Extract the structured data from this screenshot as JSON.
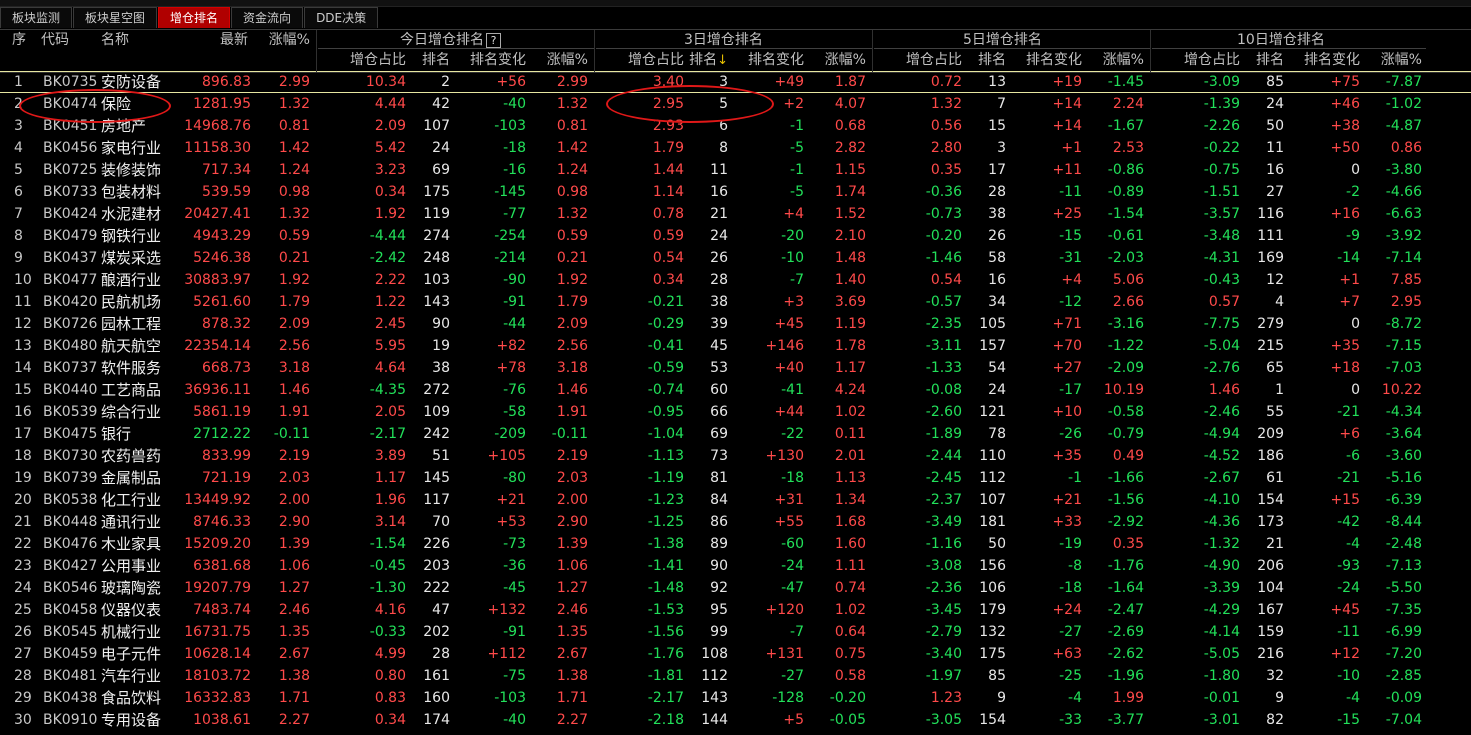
{
  "tabs": [
    {
      "label": "板块监测",
      "active": false
    },
    {
      "label": "板块星空图",
      "active": false
    },
    {
      "label": "增仓排名",
      "active": true
    },
    {
      "label": "资金流向",
      "active": false
    },
    {
      "label": "DDE决策",
      "active": false
    }
  ],
  "header": {
    "seq": "序",
    "code": "代码",
    "name": "名称",
    "latest": "最新",
    "change": "涨幅%",
    "groups": [
      "今日增仓排名",
      "3日增仓排名",
      "5日增仓排名",
      "10日增仓排名"
    ],
    "help_mark": "?",
    "sub": {
      "ratio": "增仓占比",
      "rank": "排名",
      "rank_change": "排名变化",
      "pct": "涨幅%"
    },
    "sort_arrow": "↓"
  },
  "colors": {
    "up": "#ff4a4a",
    "down": "#22e05a",
    "flat": "#e8e8e8",
    "active_tab": "#b00000",
    "highlight_circle": "#e01818"
  },
  "rows": [
    [
      "1",
      "BK0735",
      "安防设备",
      "896.83",
      "2.99",
      "10.34",
      "2",
      "+56",
      "2.99",
      "3.40",
      "3",
      "+49",
      "1.87",
      "0.72",
      "13",
      "+19",
      "-1.45",
      "-3.09",
      "85",
      "+75",
      "-7.87"
    ],
    [
      "2",
      "BK0474",
      "保险",
      "1281.95",
      "1.32",
      "4.44",
      "42",
      "-40",
      "1.32",
      "2.95",
      "5",
      "+2",
      "4.07",
      "1.32",
      "7",
      "+14",
      "2.24",
      "-1.39",
      "24",
      "+46",
      "-1.02"
    ],
    [
      "3",
      "BK0451",
      "房地产",
      "14968.76",
      "0.81",
      "2.09",
      "107",
      "-103",
      "0.81",
      "2.93",
      "6",
      "-1",
      "0.68",
      "0.56",
      "15",
      "+14",
      "-1.67",
      "-2.26",
      "50",
      "+38",
      "-4.87"
    ],
    [
      "4",
      "BK0456",
      "家电行业",
      "11158.30",
      "1.42",
      "5.42",
      "24",
      "-18",
      "1.42",
      "1.79",
      "8",
      "-5",
      "2.82",
      "2.80",
      "3",
      "+1",
      "2.53",
      "-0.22",
      "11",
      "+50",
      "0.86"
    ],
    [
      "5",
      "BK0725",
      "装修装饰",
      "717.34",
      "1.24",
      "3.23",
      "69",
      "-16",
      "1.24",
      "1.44",
      "11",
      "-1",
      "1.15",
      "0.35",
      "17",
      "+11",
      "-0.86",
      "-0.75",
      "16",
      "0",
      "-3.80"
    ],
    [
      "6",
      "BK0733",
      "包装材料",
      "539.59",
      "0.98",
      "0.34",
      "175",
      "-145",
      "0.98",
      "1.14",
      "16",
      "-5",
      "1.74",
      "-0.36",
      "28",
      "-11",
      "-0.89",
      "-1.51",
      "27",
      "-2",
      "-4.66"
    ],
    [
      "7",
      "BK0424",
      "水泥建材",
      "20427.41",
      "1.32",
      "1.92",
      "119",
      "-77",
      "1.32",
      "0.78",
      "21",
      "+4",
      "1.52",
      "-0.73",
      "38",
      "+25",
      "-1.54",
      "-3.57",
      "116",
      "+16",
      "-6.63"
    ],
    [
      "8",
      "BK0479",
      "钢铁行业",
      "4943.29",
      "0.59",
      "-4.44",
      "274",
      "-254",
      "0.59",
      "0.59",
      "24",
      "-20",
      "2.10",
      "-0.20",
      "26",
      "-15",
      "-0.61",
      "-3.48",
      "111",
      "-9",
      "-3.92"
    ],
    [
      "9",
      "BK0437",
      "煤炭采选",
      "5246.38",
      "0.21",
      "-2.42",
      "248",
      "-214",
      "0.21",
      "0.54",
      "26",
      "-10",
      "1.48",
      "-1.46",
      "58",
      "-31",
      "-2.03",
      "-4.31",
      "169",
      "-14",
      "-7.14"
    ],
    [
      "10",
      "BK0477",
      "酿酒行业",
      "30883.97",
      "1.92",
      "2.22",
      "103",
      "-90",
      "1.92",
      "0.34",
      "28",
      "-7",
      "1.40",
      "0.54",
      "16",
      "+4",
      "5.06",
      "-0.43",
      "12",
      "+1",
      "7.85"
    ],
    [
      "11",
      "BK0420",
      "民航机场",
      "5261.60",
      "1.79",
      "1.22",
      "143",
      "-91",
      "1.79",
      "-0.21",
      "38",
      "+3",
      "3.69",
      "-0.57",
      "34",
      "-12",
      "2.66",
      "0.57",
      "4",
      "+7",
      "2.95"
    ],
    [
      "12",
      "BK0726",
      "园林工程",
      "878.32",
      "2.09",
      "2.45",
      "90",
      "-44",
      "2.09",
      "-0.29",
      "39",
      "+45",
      "1.19",
      "-2.35",
      "105",
      "+71",
      "-3.16",
      "-7.75",
      "279",
      "0",
      "-8.72"
    ],
    [
      "13",
      "BK0480",
      "航天航空",
      "22354.14",
      "2.56",
      "5.95",
      "19",
      "+82",
      "2.56",
      "-0.41",
      "45",
      "+146",
      "1.78",
      "-3.11",
      "157",
      "+70",
      "-1.22",
      "-5.04",
      "215",
      "+35",
      "-7.15"
    ],
    [
      "14",
      "BK0737",
      "软件服务",
      "668.73",
      "3.18",
      "4.64",
      "38",
      "+78",
      "3.18",
      "-0.59",
      "53",
      "+40",
      "1.17",
      "-1.33",
      "54",
      "+27",
      "-2.09",
      "-2.76",
      "65",
      "+18",
      "-7.03"
    ],
    [
      "15",
      "BK0440",
      "工艺商品",
      "36936.11",
      "1.46",
      "-4.35",
      "272",
      "-76",
      "1.46",
      "-0.74",
      "60",
      "-41",
      "4.24",
      "-0.08",
      "24",
      "-17",
      "10.19",
      "1.46",
      "1",
      "0",
      "10.22"
    ],
    [
      "16",
      "BK0539",
      "综合行业",
      "5861.19",
      "1.91",
      "2.05",
      "109",
      "-58",
      "1.91",
      "-0.95",
      "66",
      "+44",
      "1.02",
      "-2.60",
      "121",
      "+10",
      "-0.58",
      "-2.46",
      "55",
      "-21",
      "-4.34"
    ],
    [
      "17",
      "BK0475",
      "银行",
      "2712.22",
      "-0.11",
      "-2.17",
      "242",
      "-209",
      "-0.11",
      "-1.04",
      "69",
      "-22",
      "0.11",
      "-1.89",
      "78",
      "-26",
      "-0.79",
      "-4.94",
      "209",
      "+6",
      "-3.64"
    ],
    [
      "18",
      "BK0730",
      "农药兽药",
      "833.99",
      "2.19",
      "3.89",
      "51",
      "+105",
      "2.19",
      "-1.13",
      "73",
      "+130",
      "2.01",
      "-2.44",
      "110",
      "+35",
      "0.49",
      "-4.52",
      "186",
      "-6",
      "-3.60"
    ],
    [
      "19",
      "BK0739",
      "金属制品",
      "721.19",
      "2.03",
      "1.17",
      "145",
      "-80",
      "2.03",
      "-1.19",
      "81",
      "-18",
      "1.13",
      "-2.45",
      "112",
      "-1",
      "-1.66",
      "-2.67",
      "61",
      "-21",
      "-5.16"
    ],
    [
      "20",
      "BK0538",
      "化工行业",
      "13449.92",
      "2.00",
      "1.96",
      "117",
      "+21",
      "2.00",
      "-1.23",
      "84",
      "+31",
      "1.34",
      "-2.37",
      "107",
      "+21",
      "-1.56",
      "-4.10",
      "154",
      "+15",
      "-6.39"
    ],
    [
      "21",
      "BK0448",
      "通讯行业",
      "8746.33",
      "2.90",
      "3.14",
      "70",
      "+53",
      "2.90",
      "-1.25",
      "86",
      "+55",
      "1.68",
      "-3.49",
      "181",
      "+33",
      "-2.92",
      "-4.36",
      "173",
      "-42",
      "-8.44"
    ],
    [
      "22",
      "BK0476",
      "木业家具",
      "15209.20",
      "1.39",
      "-1.54",
      "226",
      "-73",
      "1.39",
      "-1.38",
      "89",
      "-60",
      "1.60",
      "-1.16",
      "50",
      "-19",
      "0.35",
      "-1.32",
      "21",
      "-4",
      "-2.48"
    ],
    [
      "23",
      "BK0427",
      "公用事业",
      "6381.68",
      "1.06",
      "-0.45",
      "203",
      "-36",
      "1.06",
      "-1.41",
      "90",
      "-24",
      "1.11",
      "-3.08",
      "156",
      "-8",
      "-1.76",
      "-4.90",
      "206",
      "-93",
      "-7.13"
    ],
    [
      "24",
      "BK0546",
      "玻璃陶瓷",
      "19207.79",
      "1.27",
      "-1.30",
      "222",
      "-45",
      "1.27",
      "-1.48",
      "92",
      "-47",
      "0.74",
      "-2.36",
      "106",
      "-18",
      "-1.64",
      "-3.39",
      "104",
      "-24",
      "-5.50"
    ],
    [
      "25",
      "BK0458",
      "仪器仪表",
      "7483.74",
      "2.46",
      "4.16",
      "47",
      "+132",
      "2.46",
      "-1.53",
      "95",
      "+120",
      "1.02",
      "-3.45",
      "179",
      "+24",
      "-2.47",
      "-4.29",
      "167",
      "+45",
      "-7.35"
    ],
    [
      "26",
      "BK0545",
      "机械行业",
      "16731.75",
      "1.35",
      "-0.33",
      "202",
      "-91",
      "1.35",
      "-1.56",
      "99",
      "-7",
      "0.64",
      "-2.79",
      "132",
      "-27",
      "-2.69",
      "-4.14",
      "159",
      "-11",
      "-6.99"
    ],
    [
      "27",
      "BK0459",
      "电子元件",
      "10628.14",
      "2.67",
      "4.99",
      "28",
      "+112",
      "2.67",
      "-1.76",
      "108",
      "+131",
      "0.75",
      "-3.40",
      "175",
      "+63",
      "-2.62",
      "-5.05",
      "216",
      "+12",
      "-7.20"
    ],
    [
      "28",
      "BK0481",
      "汽车行业",
      "18103.72",
      "1.38",
      "0.80",
      "161",
      "-75",
      "1.38",
      "-1.81",
      "112",
      "-27",
      "0.58",
      "-1.97",
      "85",
      "-25",
      "-1.96",
      "-1.80",
      "32",
      "-10",
      "-2.85"
    ],
    [
      "29",
      "BK0438",
      "食品饮料",
      "16332.83",
      "1.71",
      "0.83",
      "160",
      "-103",
      "1.71",
      "-2.17",
      "143",
      "-128",
      "-0.20",
      "1.23",
      "9",
      "-4",
      "1.99",
      "-0.01",
      "9",
      "-4",
      "-0.09"
    ],
    [
      "30",
      "BK0910",
      "专用设备",
      "1038.61",
      "2.27",
      "0.34",
      "174",
      "-40",
      "2.27",
      "-2.18",
      "144",
      "+5",
      "-0.05",
      "-3.05",
      "154",
      "-33",
      "-3.77",
      "-3.01",
      "82",
      "-15",
      "-7.04"
    ]
  ]
}
